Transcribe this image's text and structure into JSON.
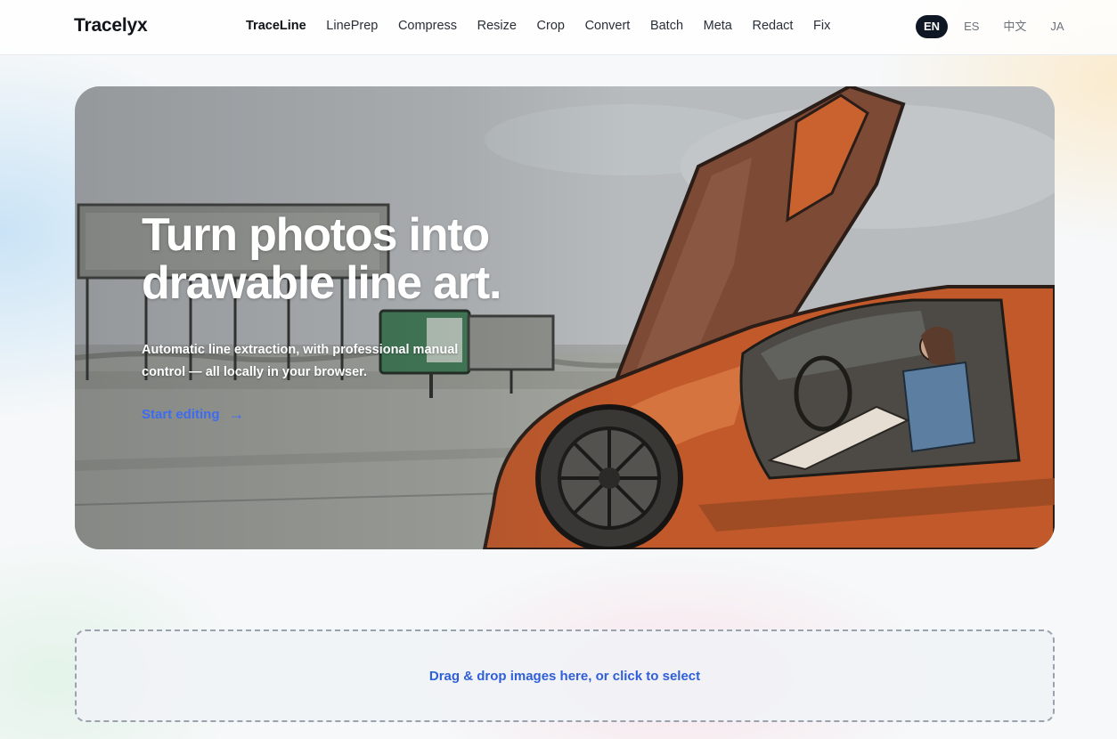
{
  "brand": "Tracelyx",
  "nav": [
    {
      "label": "TraceLine",
      "active": true
    },
    {
      "label": "LinePrep"
    },
    {
      "label": "Compress"
    },
    {
      "label": "Resize"
    },
    {
      "label": "Crop"
    },
    {
      "label": "Convert"
    },
    {
      "label": "Batch"
    },
    {
      "label": "Meta"
    },
    {
      "label": "Redact"
    },
    {
      "label": "Fix"
    }
  ],
  "languages": [
    {
      "label": "EN",
      "active": true
    },
    {
      "label": "ES"
    },
    {
      "label": "中文"
    },
    {
      "label": "JA"
    }
  ],
  "hero": {
    "title_line1": "Turn photos into",
    "title_line2": "drawable line art.",
    "subtitle_line1": "Automatic line extraction, with professional manual",
    "subtitle_line2": "control — all locally in your browser.",
    "cta_label": "Start editing",
    "cta_arrow": "→",
    "image_description_icon": "line-art-car-photo"
  },
  "dropzone": {
    "label": "Drag & drop images here, or click to select"
  },
  "colors": {
    "accent": "#3d6cf0",
    "dropzone_text": "#2f5fd8",
    "lang_active_bg": "#0f1725",
    "car_orange": "#d4622e"
  }
}
